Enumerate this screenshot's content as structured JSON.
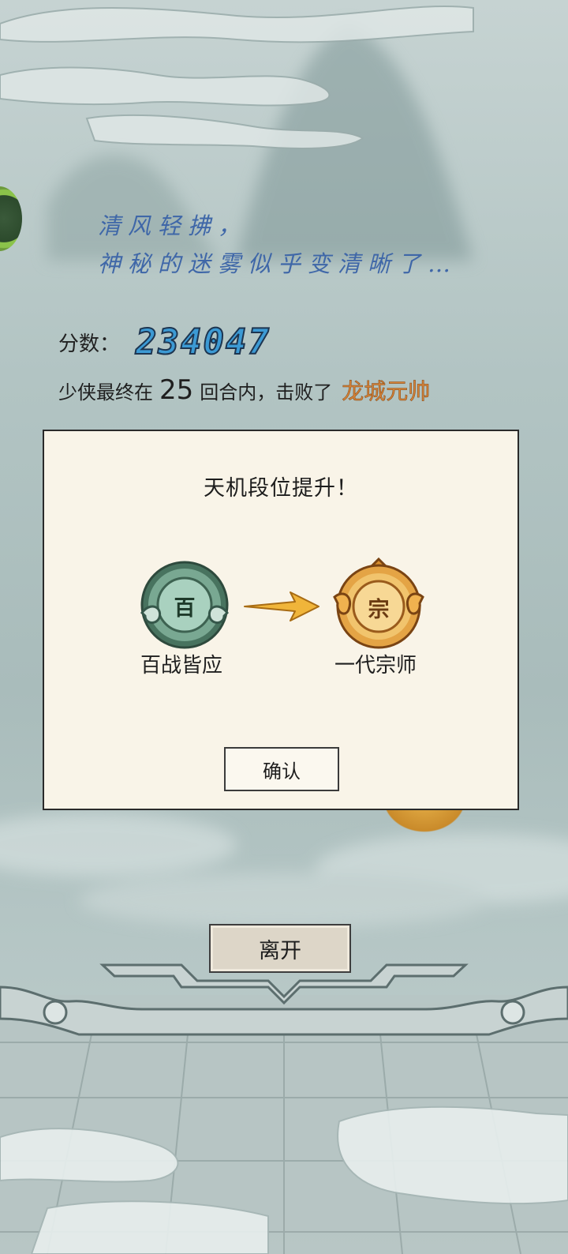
{
  "poem": {
    "line1": "清风轻拂，",
    "line2": "神秘的迷雾似乎变清晰了…"
  },
  "score": {
    "label": "分数：",
    "value": "234047"
  },
  "summary": {
    "prefix": "少侠最终在",
    "rounds": "25",
    "middle": "回合内，击败了",
    "boss": "龙城元帅"
  },
  "modal": {
    "title": "天机段位提升！",
    "old_rank": {
      "label": "百战皆应",
      "badge_char": "百"
    },
    "new_rank": {
      "label": "一代宗师",
      "badge_char": "宗"
    },
    "confirm_label": "确认"
  },
  "leave_label": "离开",
  "colors": {
    "poem": "#3f67a8",
    "score": "#3c9ad4",
    "boss": "#d6843a",
    "panel": "#f9f4e8",
    "old_badge": "#5f9a7e",
    "new_badge": "#e4a445"
  },
  "icons": {
    "old_rank_badge": "jade-medal-icon",
    "new_rank_badge": "gold-medal-icon",
    "arrow": "arrow-right-icon",
    "side": "green-round-badge-icon"
  }
}
